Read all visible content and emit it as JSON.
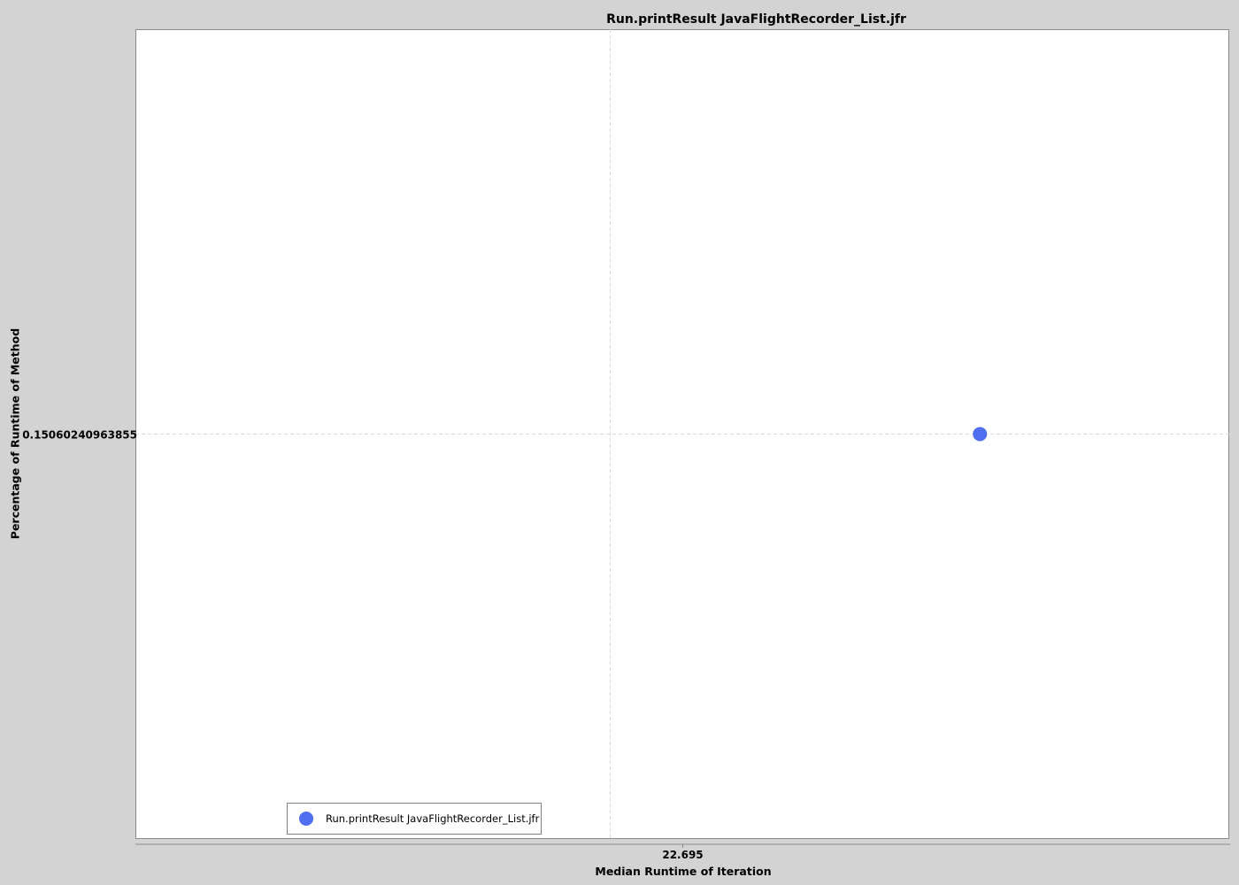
{
  "chart_data": {
    "type": "scatter",
    "title": "Run.printResult JavaFlightRecorder_List.jfr",
    "xlabel": "Median Runtime of Iteration",
    "ylabel": "Percentage of Runtime of Method",
    "x_ticks": [
      "22.695"
    ],
    "y_ticks": [
      "0.15060240963855"
    ],
    "xlim": [
      22.66,
      22.73
    ],
    "ylim": [
      0.1306,
      0.1706
    ],
    "grid": true,
    "legend_position": "bottom-left",
    "series": [
      {
        "name": "Run.printResult JavaFlightRecorder_List.jfr",
        "color": "#4f6ef0",
        "points": [
          {
            "x": 22.714,
            "y": 0.15060240963855
          }
        ]
      }
    ]
  }
}
